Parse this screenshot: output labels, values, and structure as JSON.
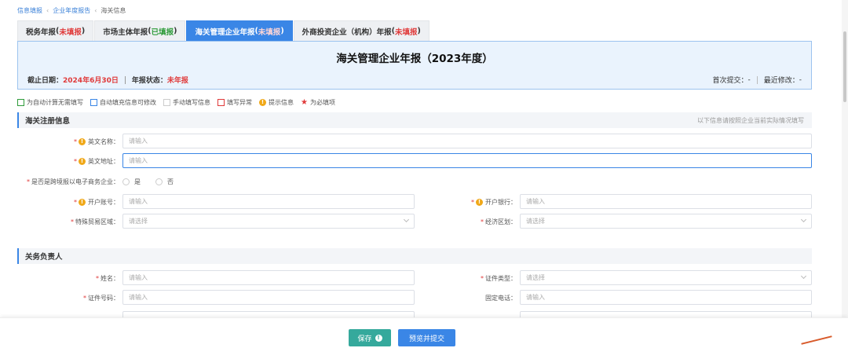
{
  "breadcrumb": {
    "items": [
      "信息填报",
      "企业年度报告",
      "海关信息"
    ]
  },
  "tabs": [
    {
      "label": "税务年报",
      "status": "未填报"
    },
    {
      "label": "市场主体年报",
      "status": "已填报"
    },
    {
      "label": "海关管理企业年报",
      "status": "未填报"
    },
    {
      "label": "外商投资企业（机构）年报",
      "status": "未填报"
    }
  ],
  "banner": {
    "title": "海关管理企业年报（2023年度）",
    "deadline_label": "截止日期：",
    "deadline_value": "2024年6月30日",
    "status_label": "年报状态：",
    "status_value": "未年报",
    "first_submit_label": "首次提交：",
    "first_submit_value": "-",
    "last_modified_label": "最近修改：",
    "last_modified_value": "-"
  },
  "legend": {
    "auto_calc": "为自动计算无需填写",
    "auto_fill": "自动填充信息可修改",
    "manual": "手动填写信息",
    "error": "填写异常",
    "tip": "提示信息",
    "required": "为必填项"
  },
  "section_customs": {
    "title": "海关注册信息",
    "hint": "以下信息请按照企业当前实际情况填写",
    "english_name_label": "英文名称：",
    "english_name_placeholder": "请输入",
    "english_address_label": "英文地址：",
    "english_address_placeholder": "请输入",
    "ecommerce_label": "是否是跨境报以电子商务企业：",
    "ecommerce_yes": "是",
    "ecommerce_no": "否",
    "account_label": "开户账号：",
    "account_placeholder": "请输入",
    "bank_label": "开户银行：",
    "bank_placeholder": "请输入",
    "trade_zone_label": "特殊贸易区域：",
    "trade_zone_placeholder": "请选择",
    "economic_zone_label": "经济区划：",
    "economic_zone_placeholder": "请选择"
  },
  "section_contact": {
    "title": "关务负责人",
    "name_label": "姓名：",
    "name_placeholder": "请输入",
    "id_type_label": "证件类型：",
    "id_type_placeholder": "请选择",
    "id_number_label": "证件号码：",
    "id_number_placeholder": "请输入",
    "phone_label": "固定电话：",
    "phone_placeholder": "请输入"
  },
  "footer": {
    "save_label": "保存",
    "preview_label": "预览并提交"
  },
  "colors": {
    "accent": "#3a86e6",
    "required": "#e03a3a",
    "success": "#2e9b3a",
    "save_button": "#35a99c",
    "warn_icon": "#f0a818"
  },
  "icons": [
    "warn-icon",
    "chevron-left-icon",
    "chevron-down-icon",
    "radio-icon"
  ]
}
